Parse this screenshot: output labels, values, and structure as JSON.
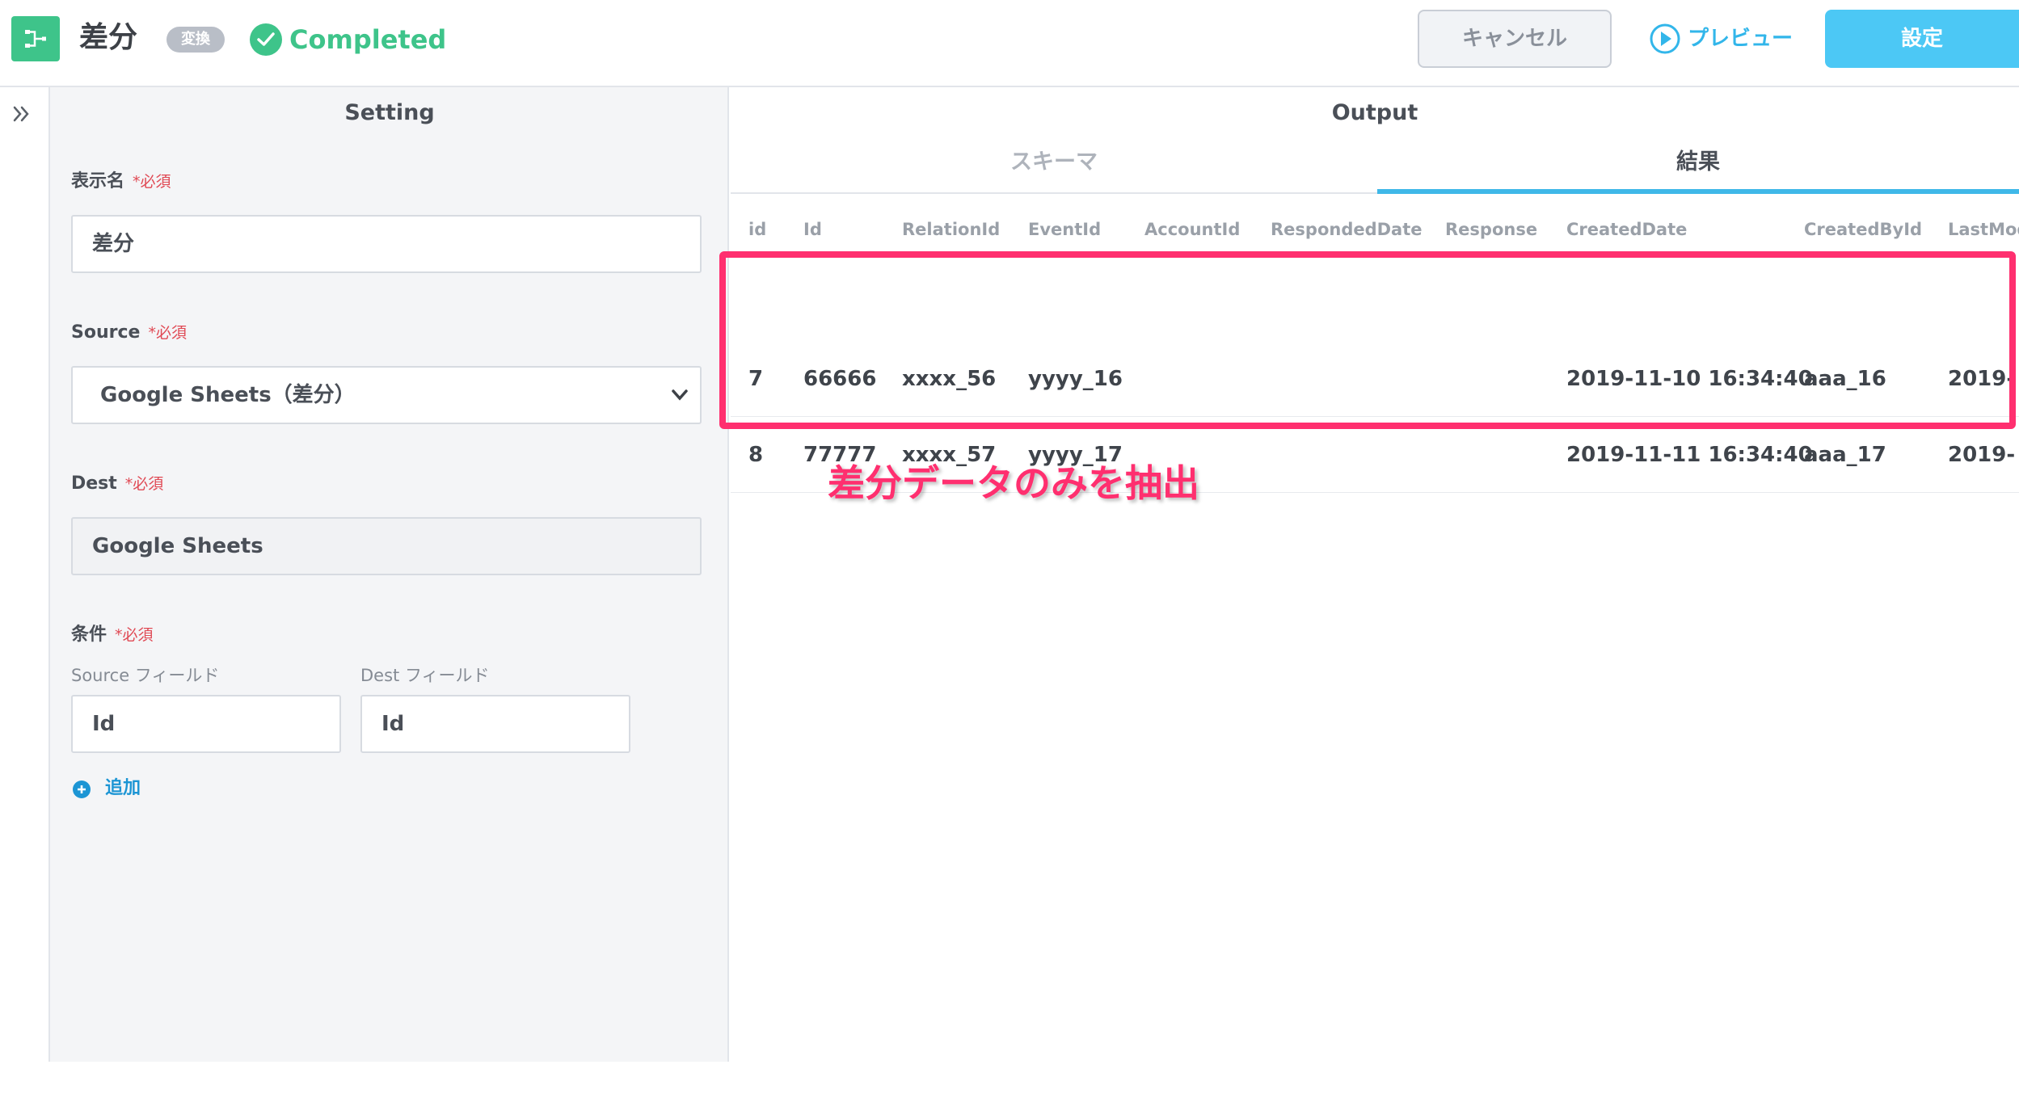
{
  "header": {
    "title": "差分",
    "type_badge": "変換",
    "status": "Completed",
    "cancel_label": "キャンセル",
    "preview_label": "プレビュー",
    "save_label": "設定"
  },
  "setting": {
    "title": "Setting",
    "required_mark": "*必須",
    "display_name": {
      "label": "表示名",
      "value": "差分"
    },
    "source": {
      "label": "Source",
      "selected": "Google Sheets（差分）"
    },
    "dest": {
      "label": "Dest",
      "value": "Google Sheets"
    },
    "condition": {
      "label": "条件",
      "source_field_label": "Source フィールド",
      "dest_field_label": "Dest フィールド",
      "source_field_value": "Id",
      "dest_field_value": "Id",
      "add_label": "追加"
    }
  },
  "output": {
    "title": "Output",
    "tabs": [
      "スキーマ",
      "結果"
    ],
    "active_tab": "結果",
    "columns": [
      "id",
      "Id",
      "RelationId",
      "EventId",
      "AccountId",
      "RespondedDate",
      "Response",
      "CreatedDate",
      "CreatedById",
      "LastMod"
    ],
    "rows": [
      [
        "7",
        "66666",
        "xxxx_56",
        "yyyy_16",
        "",
        "",
        "",
        "2019-11-10 16:34:40",
        "aaa_16",
        "2019-"
      ],
      [
        "8",
        "77777",
        "xxxx_57",
        "yyyy_17",
        "",
        "",
        "",
        "2019-11-11 16:34:40",
        "aaa_17",
        "2019-"
      ]
    ],
    "annotation": "差分データのみを抽出"
  },
  "colors": {
    "accent_green": "#3ec48a",
    "accent_blue": "#4cc8f5",
    "highlight_pink": "#ff2f6f"
  },
  "icons": {
    "app": "flow-diff-icon",
    "status": "check-circle-icon",
    "preview": "play-circle-icon",
    "expand": "double-chevron-right-icon",
    "select": "chevron-down-icon",
    "add": "plus-circle-icon"
  }
}
